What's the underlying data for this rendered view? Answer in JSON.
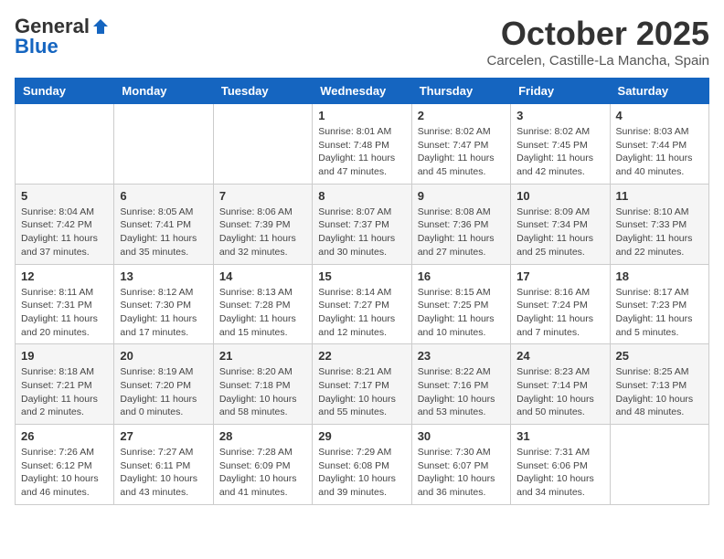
{
  "header": {
    "logo_general": "General",
    "logo_blue": "Blue",
    "month_title": "October 2025",
    "subtitle": "Carcelen, Castille-La Mancha, Spain"
  },
  "weekdays": [
    "Sunday",
    "Monday",
    "Tuesday",
    "Wednesday",
    "Thursday",
    "Friday",
    "Saturday"
  ],
  "weeks": [
    [
      {
        "day": "",
        "info": ""
      },
      {
        "day": "",
        "info": ""
      },
      {
        "day": "",
        "info": ""
      },
      {
        "day": "1",
        "info": "Sunrise: 8:01 AM\nSunset: 7:48 PM\nDaylight: 11 hours and 47 minutes."
      },
      {
        "day": "2",
        "info": "Sunrise: 8:02 AM\nSunset: 7:47 PM\nDaylight: 11 hours and 45 minutes."
      },
      {
        "day": "3",
        "info": "Sunrise: 8:02 AM\nSunset: 7:45 PM\nDaylight: 11 hours and 42 minutes."
      },
      {
        "day": "4",
        "info": "Sunrise: 8:03 AM\nSunset: 7:44 PM\nDaylight: 11 hours and 40 minutes."
      }
    ],
    [
      {
        "day": "5",
        "info": "Sunrise: 8:04 AM\nSunset: 7:42 PM\nDaylight: 11 hours and 37 minutes."
      },
      {
        "day": "6",
        "info": "Sunrise: 8:05 AM\nSunset: 7:41 PM\nDaylight: 11 hours and 35 minutes."
      },
      {
        "day": "7",
        "info": "Sunrise: 8:06 AM\nSunset: 7:39 PM\nDaylight: 11 hours and 32 minutes."
      },
      {
        "day": "8",
        "info": "Sunrise: 8:07 AM\nSunset: 7:37 PM\nDaylight: 11 hours and 30 minutes."
      },
      {
        "day": "9",
        "info": "Sunrise: 8:08 AM\nSunset: 7:36 PM\nDaylight: 11 hours and 27 minutes."
      },
      {
        "day": "10",
        "info": "Sunrise: 8:09 AM\nSunset: 7:34 PM\nDaylight: 11 hours and 25 minutes."
      },
      {
        "day": "11",
        "info": "Sunrise: 8:10 AM\nSunset: 7:33 PM\nDaylight: 11 hours and 22 minutes."
      }
    ],
    [
      {
        "day": "12",
        "info": "Sunrise: 8:11 AM\nSunset: 7:31 PM\nDaylight: 11 hours and 20 minutes."
      },
      {
        "day": "13",
        "info": "Sunrise: 8:12 AM\nSunset: 7:30 PM\nDaylight: 11 hours and 17 minutes."
      },
      {
        "day": "14",
        "info": "Sunrise: 8:13 AM\nSunset: 7:28 PM\nDaylight: 11 hours and 15 minutes."
      },
      {
        "day": "15",
        "info": "Sunrise: 8:14 AM\nSunset: 7:27 PM\nDaylight: 11 hours and 12 minutes."
      },
      {
        "day": "16",
        "info": "Sunrise: 8:15 AM\nSunset: 7:25 PM\nDaylight: 11 hours and 10 minutes."
      },
      {
        "day": "17",
        "info": "Sunrise: 8:16 AM\nSunset: 7:24 PM\nDaylight: 11 hours and 7 minutes."
      },
      {
        "day": "18",
        "info": "Sunrise: 8:17 AM\nSunset: 7:23 PM\nDaylight: 11 hours and 5 minutes."
      }
    ],
    [
      {
        "day": "19",
        "info": "Sunrise: 8:18 AM\nSunset: 7:21 PM\nDaylight: 11 hours and 2 minutes."
      },
      {
        "day": "20",
        "info": "Sunrise: 8:19 AM\nSunset: 7:20 PM\nDaylight: 11 hours and 0 minutes."
      },
      {
        "day": "21",
        "info": "Sunrise: 8:20 AM\nSunset: 7:18 PM\nDaylight: 10 hours and 58 minutes."
      },
      {
        "day": "22",
        "info": "Sunrise: 8:21 AM\nSunset: 7:17 PM\nDaylight: 10 hours and 55 minutes."
      },
      {
        "day": "23",
        "info": "Sunrise: 8:22 AM\nSunset: 7:16 PM\nDaylight: 10 hours and 53 minutes."
      },
      {
        "day": "24",
        "info": "Sunrise: 8:23 AM\nSunset: 7:14 PM\nDaylight: 10 hours and 50 minutes."
      },
      {
        "day": "25",
        "info": "Sunrise: 8:25 AM\nSunset: 7:13 PM\nDaylight: 10 hours and 48 minutes."
      }
    ],
    [
      {
        "day": "26",
        "info": "Sunrise: 7:26 AM\nSunset: 6:12 PM\nDaylight: 10 hours and 46 minutes."
      },
      {
        "day": "27",
        "info": "Sunrise: 7:27 AM\nSunset: 6:11 PM\nDaylight: 10 hours and 43 minutes."
      },
      {
        "day": "28",
        "info": "Sunrise: 7:28 AM\nSunset: 6:09 PM\nDaylight: 10 hours and 41 minutes."
      },
      {
        "day": "29",
        "info": "Sunrise: 7:29 AM\nSunset: 6:08 PM\nDaylight: 10 hours and 39 minutes."
      },
      {
        "day": "30",
        "info": "Sunrise: 7:30 AM\nSunset: 6:07 PM\nDaylight: 10 hours and 36 minutes."
      },
      {
        "day": "31",
        "info": "Sunrise: 7:31 AM\nSunset: 6:06 PM\nDaylight: 10 hours and 34 minutes."
      },
      {
        "day": "",
        "info": ""
      }
    ]
  ]
}
